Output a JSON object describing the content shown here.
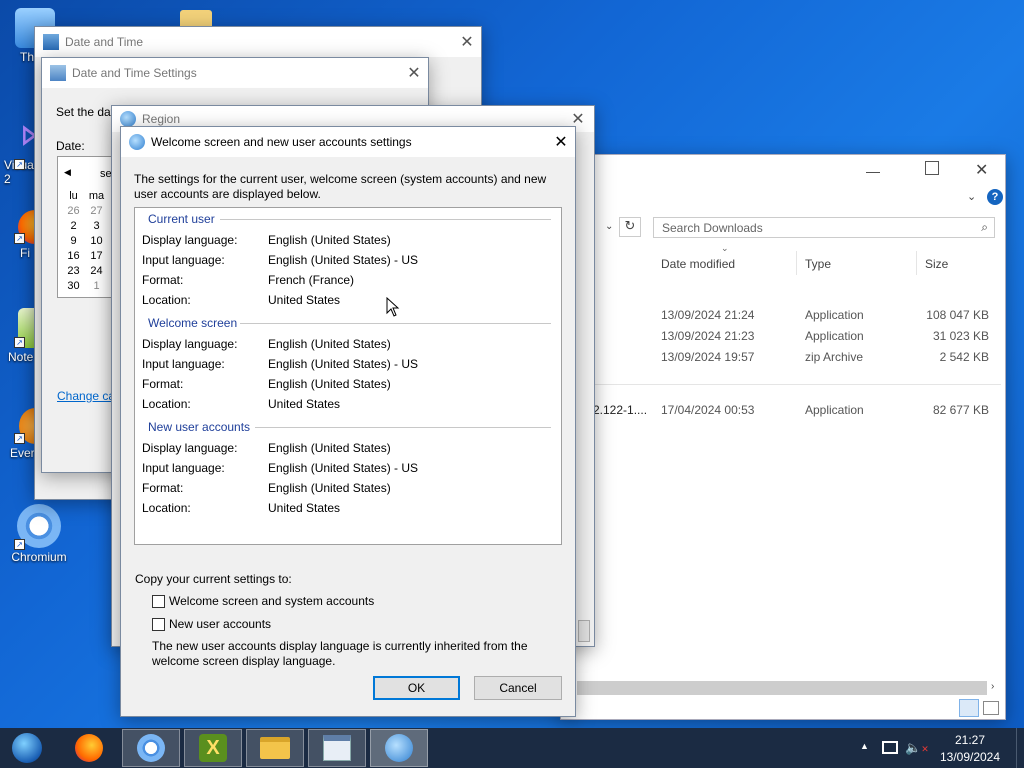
{
  "desktop": {
    "icons": [
      {
        "label": "Th",
        "icon": "this-pc-icon"
      },
      {
        "label": "Visua 2",
        "icon": "visual-studio-icon"
      },
      {
        "label": "Fi",
        "icon": "firefox-icon"
      },
      {
        "label": "Note",
        "icon": "notepad-icon"
      },
      {
        "label": "Ever",
        "icon": "everything-icon"
      },
      {
        "label": "Chromium",
        "icon": "chromium-icon"
      }
    ]
  },
  "date_time_window": {
    "title": "Date and Time"
  },
  "date_time_settings": {
    "title": "Date and Time Settings",
    "set_date_label": "Set the dat",
    "date_label": "Date:",
    "month_partial": "se",
    "weekday_headers": [
      "lu",
      "ma",
      "m"
    ],
    "weeks": [
      [
        "26",
        "27",
        ""
      ],
      [
        "2",
        "3",
        ""
      ],
      [
        "9",
        "10",
        ""
      ],
      [
        "16",
        "17",
        ""
      ],
      [
        "23",
        "24",
        ""
      ],
      [
        "30",
        "1",
        ""
      ]
    ],
    "change_link": "Change ca"
  },
  "region_window": {
    "title": "Region"
  },
  "explorer": {
    "search_placeholder": "Search Downloads",
    "columns": {
      "date": "Date modified",
      "type": "Type",
      "size": "Size"
    },
    "rows": [
      {
        "name": "",
        "date": "13/09/2024 21:24",
        "type": "Application",
        "size": "108 047 KB"
      },
      {
        "name": "",
        "date": "13/09/2024 21:23",
        "type": "Application",
        "size": "31 023 KB"
      },
      {
        "name": "",
        "date": "13/09/2024 19:57",
        "type": "zip Archive",
        "size": "2 542 KB"
      },
      {
        "name": "2.122-1....",
        "date": "17/04/2024 00:53",
        "type": "Application",
        "size": "82 677 KB"
      }
    ]
  },
  "dialog": {
    "title": "Welcome screen and new user accounts settings",
    "intro": "The settings for the current user, welcome screen (system accounts) and new user accounts are displayed below.",
    "sections": [
      {
        "heading": "Current user",
        "rows": [
          {
            "label": "Display language:",
            "value": "English (United States)"
          },
          {
            "label": "Input language:",
            "value": "English (United States) - US"
          },
          {
            "label": "Format:",
            "value": "French (France)"
          },
          {
            "label": "Location:",
            "value": "United States"
          }
        ]
      },
      {
        "heading": "Welcome screen",
        "rows": [
          {
            "label": "Display language:",
            "value": "English (United States)"
          },
          {
            "label": "Input language:",
            "value": "English (United States) - US"
          },
          {
            "label": "Format:",
            "value": "English (United States)"
          },
          {
            "label": "Location:",
            "value": "United States"
          }
        ]
      },
      {
        "heading": "New user accounts",
        "rows": [
          {
            "label": "Display language:",
            "value": "English (United States)"
          },
          {
            "label": "Input language:",
            "value": "English (United States) - US"
          },
          {
            "label": "Format:",
            "value": "English (United States)"
          },
          {
            "label": "Location:",
            "value": "United States"
          }
        ]
      }
    ],
    "copy_label": "Copy your current settings to:",
    "checkbox_welcome": "Welcome screen and system accounts",
    "checkbox_new_users": "New user accounts",
    "note": "The new user accounts display language is currently inherited from the welcome screen display language.",
    "ok": "OK",
    "cancel": "Cancel"
  },
  "taskbar": {
    "time": "21:27",
    "date": "13/09/2024"
  }
}
